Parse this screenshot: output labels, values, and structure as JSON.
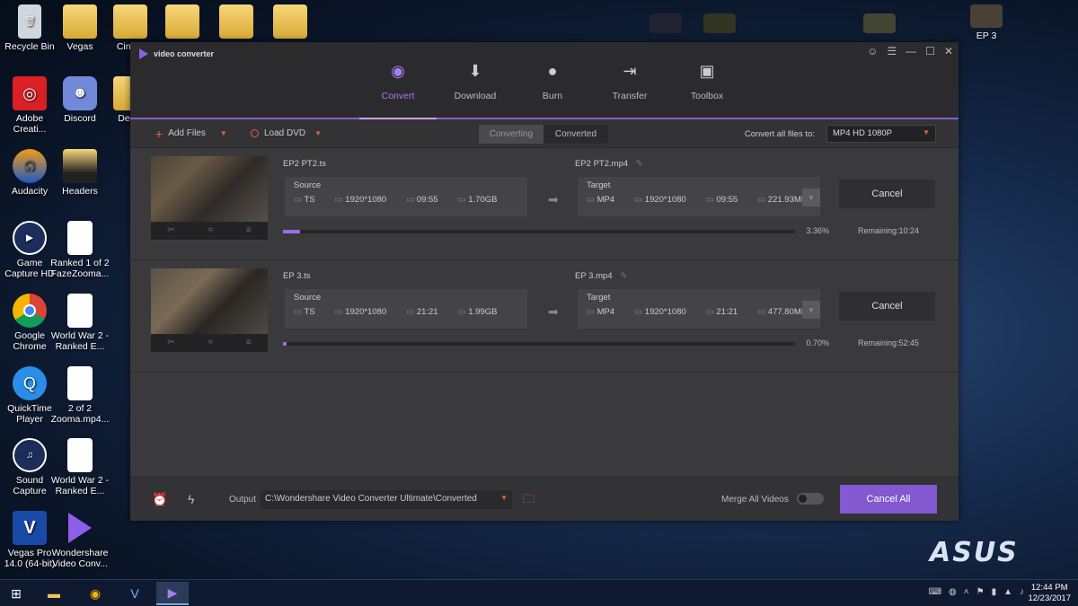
{
  "desktop": {
    "icons": [
      {
        "label": "Recycle Bin"
      },
      {
        "label": "Vegas"
      },
      {
        "label": "Cina..."
      },
      {
        "label": "Adobe Creati..."
      },
      {
        "label": "Discord"
      },
      {
        "label": "Des..."
      },
      {
        "label": "Audacity"
      },
      {
        "label": "Headers"
      },
      {
        "label": "Game Capture HD"
      },
      {
        "label": "Ranked 1 of 2 FazeZooma..."
      },
      {
        "label": "Google Chrome"
      },
      {
        "label": "World War 2 - Ranked E..."
      },
      {
        "label": "QuickTime Player"
      },
      {
        "label": "2 of 2 Zooma.mp4..."
      },
      {
        "label": "Sound Capture"
      },
      {
        "label": "World War 2 - Ranked E..."
      },
      {
        "label": "Vegas Pro 14.0 (64-bit)"
      },
      {
        "label": "Wondershare Video Conv..."
      },
      {
        "label": "EP 3"
      }
    ],
    "brand": "ASUS"
  },
  "app": {
    "title": "video converter",
    "nav": [
      {
        "label": "Convert",
        "icon": "play-icon"
      },
      {
        "label": "Download",
        "icon": "download-icon"
      },
      {
        "label": "Burn",
        "icon": "disc-icon"
      },
      {
        "label": "Transfer",
        "icon": "transfer-icon"
      },
      {
        "label": "Toolbox",
        "icon": "toolbox-icon"
      }
    ],
    "toolbar": {
      "add_files": "Add Files",
      "load_dvd": "Load DVD",
      "tab_converting": "Converting",
      "tab_converted": "Converted",
      "convert_all_label": "Convert all files to:",
      "format": "MP4 HD 1080P"
    },
    "jobs": [
      {
        "source_name": "EP2 PT2.ts",
        "target_name": "EP2 PT2.mp4",
        "source_label": "Source",
        "target_label": "Target",
        "source": {
          "format": "TS",
          "resolution": "1920*1080",
          "duration": "09:55",
          "size": "1.70GB"
        },
        "target": {
          "format": "MP4",
          "resolution": "1920*1080",
          "duration": "09:55",
          "size": "221.93MB"
        },
        "progress": 0.0336,
        "progress_text": "3.36%",
        "remaining": "Remaining:10:24",
        "cancel": "Cancel"
      },
      {
        "source_name": "EP 3.ts",
        "target_name": "EP 3.mp4",
        "source_label": "Source",
        "target_label": "Target",
        "source": {
          "format": "TS",
          "resolution": "1920*1080",
          "duration": "21:21",
          "size": "1.99GB"
        },
        "target": {
          "format": "MP4",
          "resolution": "1920*1080",
          "duration": "21:21",
          "size": "477.80MB"
        },
        "progress": 0.007,
        "progress_text": "0.70%",
        "remaining": "Remaining:52:45",
        "cancel": "Cancel"
      }
    ],
    "footer": {
      "output_label": "Output",
      "output_path": "C:\\Wondershare Video Converter Ultimate\\Converted",
      "merge_label": "Merge All Videos",
      "cancel_all": "Cancel All"
    }
  },
  "taskbar": {
    "time": "12:44 PM",
    "date": "12/23/2017"
  }
}
